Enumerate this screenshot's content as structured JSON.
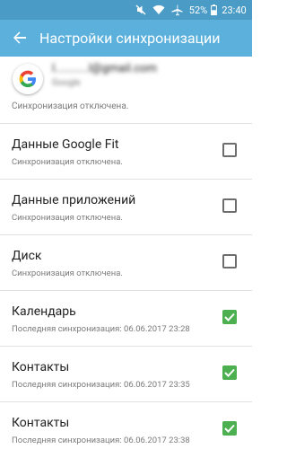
{
  "status_bar": {
    "battery_percent": "52%",
    "time": "23:40",
    "icons": [
      "mute-icon",
      "wifi-icon",
      "airplane-icon",
      "battery-icon"
    ]
  },
  "app_bar": {
    "title": "Настройки синхронизации",
    "back_icon": "arrow-back-icon"
  },
  "account": {
    "email": "l...........l@gmail.com",
    "type": "Google",
    "logo_letter": "G"
  },
  "partial_status": "Синхронизация отключена.",
  "items": [
    {
      "title": "Данные Google Fit",
      "status": "Синхронизация отключена.",
      "checked": false
    },
    {
      "title": "Данные приложений",
      "status": "Синхронизация отключена.",
      "checked": false
    },
    {
      "title": "Диск",
      "status": "Синхронизация отключена.",
      "checked": false
    },
    {
      "title": "Календарь",
      "status": "Последняя синхронизация: 06.06.2017 23:28",
      "checked": true
    },
    {
      "title": "Контакты",
      "status": "Последняя синхронизация: 06.06.2017 23:35",
      "checked": true
    },
    {
      "title": "Контакты",
      "status": "Последняя синхронизация: 06.06.2017 23:38",
      "checked": true
    }
  ],
  "colors": {
    "status_bar": "#4a9cc6",
    "app_bar": "#5bb0dc",
    "checkbox_checked": "#4caf50"
  }
}
